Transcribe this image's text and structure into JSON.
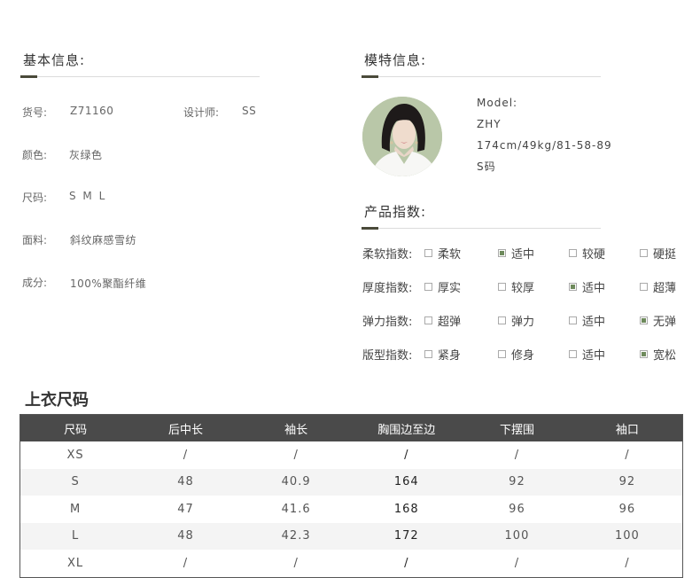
{
  "basic": {
    "title": "基本信息:",
    "fields": [
      {
        "label": "货号:",
        "value": "Z71160"
      },
      {
        "label": "设计师:",
        "value": "SS"
      },
      {
        "label": "颜色:",
        "value": "灰绿色"
      },
      {
        "label": "尺码:",
        "value": "S M L"
      },
      {
        "label": "面料:",
        "value": "斜纹麻感雪纺"
      },
      {
        "label": "成分:",
        "value": "100%聚酯纤维"
      }
    ]
  },
  "model": {
    "title": "模特信息:",
    "lines": [
      "Model:",
      "ZHY",
      "174cm/49kg/81-58-89",
      "S码"
    ]
  },
  "product_index": {
    "title": "产品指数:",
    "rows": [
      {
        "label": "柔软指数:",
        "options": [
          "柔软",
          "适中",
          "较硬",
          "硬挺"
        ],
        "checked": 1
      },
      {
        "label": "厚度指数:",
        "options": [
          "厚实",
          "较厚",
          "适中",
          "超薄"
        ],
        "checked": 2
      },
      {
        "label": "弹力指数:",
        "options": [
          "超弹",
          "弹力",
          "适中",
          "无弹"
        ],
        "checked": 3
      },
      {
        "label": "版型指数:",
        "options": [
          "紧身",
          "修身",
          "适中",
          "宽松"
        ],
        "checked": 3
      }
    ]
  },
  "size_table": {
    "title": "上衣尺码",
    "headers": [
      "尺码",
      "后中长",
      "袖长",
      "胸围边至边",
      "下摆围",
      "袖口"
    ],
    "rows": [
      [
        "XS",
        "/",
        "/",
        "/",
        "/",
        "/"
      ],
      [
        "S",
        "48",
        "40.9",
        "164",
        "92",
        "92"
      ],
      [
        "M",
        "47",
        "41.6",
        "168",
        "96",
        "96"
      ],
      [
        "L",
        "48",
        "42.3",
        "172",
        "100",
        "100"
      ],
      [
        "XL",
        "/",
        "/",
        "/",
        "/",
        "/"
      ]
    ]
  },
  "colors": {
    "accent": "#4a4a3a",
    "header_bg": "#4a4a4a",
    "check": "#6e8a5c"
  }
}
